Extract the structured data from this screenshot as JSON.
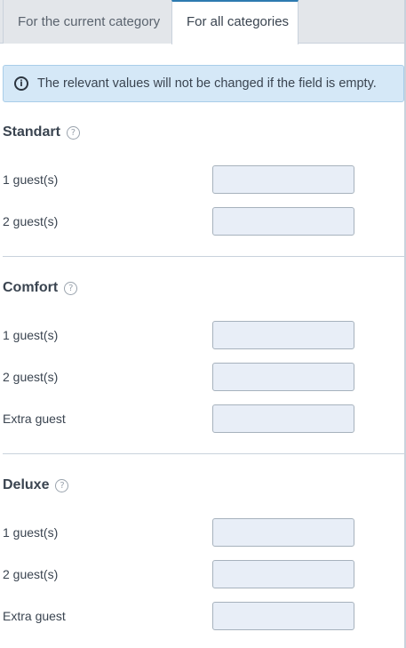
{
  "tabs": [
    {
      "label": "For the current category",
      "active": false
    },
    {
      "label": "For all categories",
      "active": true
    }
  ],
  "notice": {
    "text": "The relevant values will not be changed if the field is empty.",
    "icon": "info-icon"
  },
  "sections": [
    {
      "title": "Standart",
      "rows": [
        {
          "label": "1 guest(s)",
          "value": ""
        },
        {
          "label": "2 guest(s)",
          "value": ""
        }
      ]
    },
    {
      "title": "Comfort",
      "rows": [
        {
          "label": "1 guest(s)",
          "value": ""
        },
        {
          "label": "2 guest(s)",
          "value": ""
        },
        {
          "label": "Extra guest",
          "value": ""
        }
      ]
    },
    {
      "title": "Deluxe",
      "rows": [
        {
          "label": "1 guest(s)",
          "value": ""
        },
        {
          "label": "2 guest(s)",
          "value": ""
        },
        {
          "label": "Extra guest",
          "value": ""
        }
      ]
    }
  ],
  "colors": {
    "accent": "#2d7ab0",
    "notice_bg": "#d5e8f7",
    "field_bg": "#e8eef7"
  }
}
